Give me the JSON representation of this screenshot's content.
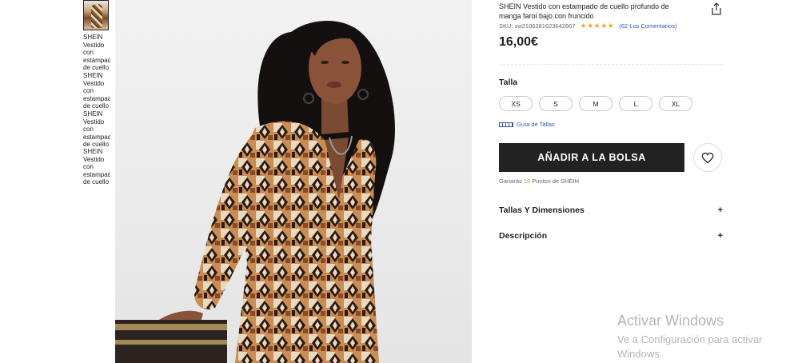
{
  "thumbnails": {
    "alt_text": "SHEIN Vestido con estampado de cuello"
  },
  "product": {
    "title": "SHEIN Vestido con estampado de cuello profundo de manga farol bajo con fruncido",
    "sku": "SKU: sw2106281623642667",
    "rating_stars": "★★★★★",
    "reviews": "(62 Los Comentarios)",
    "price": "16,00€"
  },
  "size": {
    "label": "Talla",
    "options": [
      "XS",
      "S",
      "M",
      "L",
      "XL"
    ],
    "guide": "Guía de Tallas"
  },
  "actions": {
    "add_to_bag": "AÑADIR A LA BOLSA",
    "points_prefix": "Ganarás",
    "points_value": "16",
    "points_suffix": "Puntos de SHEIN"
  },
  "sections": [
    {
      "label": "Tallas Y Dimensiones",
      "icon": "+"
    },
    {
      "label": "Descripción",
      "icon": "+"
    }
  ],
  "watermark": {
    "title": "Activar Windows",
    "subtitle": "Ve a Configuración para activar Windows."
  },
  "colors": {
    "accent_link": "#2e5ba8",
    "button_bg": "#222222",
    "star": "#f5a623",
    "points": "#f0932b"
  }
}
